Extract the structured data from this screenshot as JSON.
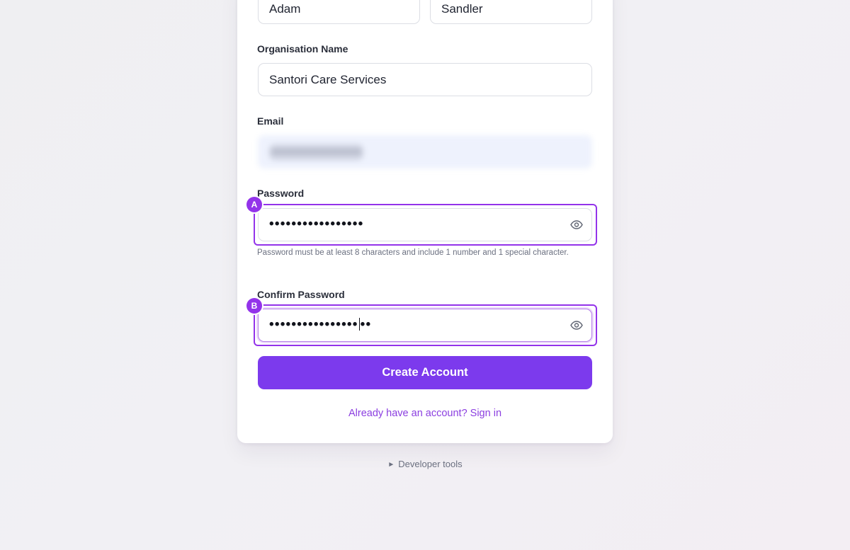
{
  "form": {
    "first_name_value": "Adam",
    "last_name_value": "Sandler",
    "organisation_label": "Organisation Name",
    "organisation_value": "Santori Care Services",
    "email_label": "Email",
    "email_value_obscured": "•••••••••••••••••••••",
    "password_label": "Password",
    "password_value": "•••••••••••••••••",
    "password_hint": "Password must be at least 8 characters and include 1 number and 1 special character.",
    "confirm_password_label": "Confirm Password",
    "confirm_password_value_before_caret": "••••••••••••••••",
    "confirm_password_value_after_caret": "••",
    "create_button_label": "Create Account",
    "signin_link_label": "Already have an account? Sign in"
  },
  "annotations": {
    "badge_a": "A",
    "badge_b": "B"
  },
  "footer": {
    "devtools_label": "Developer tools",
    "devtools_icon": "triangle-right-icon"
  },
  "icons": {
    "eye": "eye-icon"
  },
  "colors": {
    "accent": "#7c3aed",
    "highlight": "#9333ea",
    "link": "#8b3ee0",
    "email_blur_bg": "#eef2fd"
  }
}
